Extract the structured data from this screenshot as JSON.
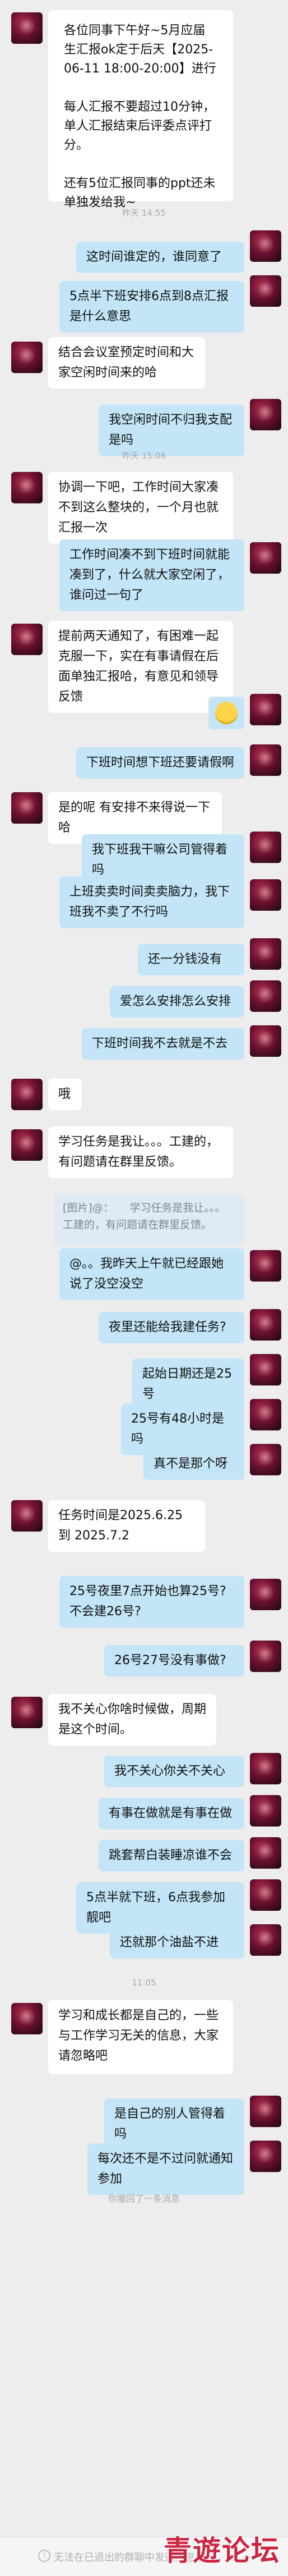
{
  "messages": [
    {
      "type": "in",
      "text": "各位同事下午好~5月应届生汇报ok定于后天【2025-06-11 18:00-20:00】进行\n\n每人汇报不要超过10分钟，单人汇报结束后评委点评打分。\n\n还有5位汇报同事的ppt还未单独发给我~"
    },
    {
      "type": "time",
      "text": "昨天 14:55"
    },
    {
      "type": "out",
      "text": "这时间谁定的，谁同意了"
    },
    {
      "type": "out",
      "text": "5点半下班安排6点到8点汇报是什么意思"
    },
    {
      "type": "in",
      "text": "结合会议室预定时间和大家空闲时间来的哈"
    },
    {
      "type": "out",
      "text": "我空闲时间不归我支配是吗"
    },
    {
      "type": "time",
      "text": "昨天 15:06"
    },
    {
      "type": "in",
      "text": "协调一下吧，工作时间大家凑不到这么整块的，一个月也就汇报一次"
    },
    {
      "type": "out",
      "text": "工作时间凑不到下班时间就能凑到了，什么就大家空闲了，谁问过一句了"
    },
    {
      "type": "in",
      "text": "提前两天通知了，有困难一起克服一下，实在有事请假在后面单独汇报哈，有意见和领导反馈"
    },
    {
      "type": "out",
      "text": "下班时间想下班还要请假啊"
    },
    {
      "type": "in",
      "text": "是的呢 有安排不来得说一下哈"
    },
    {
      "type": "out",
      "text": "我下班我干嘛公司管得着吗"
    },
    {
      "type": "out",
      "text": "上班卖卖时间卖卖脑力，我下班我不卖了不行吗"
    },
    {
      "type": "out",
      "text": "还一分钱没有"
    },
    {
      "type": "out",
      "text": "爱怎么安排怎么安排"
    },
    {
      "type": "out",
      "text": "下班时间我不去就是不去"
    },
    {
      "type": "in",
      "text": "哦"
    },
    {
      "type": "in",
      "text": "学习任务是我让。。。工建的，有问题请在群里反馈。"
    },
    {
      "type": "quote",
      "text": "[图片]@：　　学习任务是我让。。。工建的，有问题请在群里反馈。"
    },
    {
      "type": "out",
      "text": "@。。我昨天上午就已经跟她说了没空没空"
    },
    {
      "type": "out",
      "text": "夜里还能给我建任务?"
    },
    {
      "type": "out",
      "text": "起始日期还是25号"
    },
    {
      "type": "out",
      "text": "25号有48小时是吗"
    },
    {
      "type": "out",
      "text": "真不是那个呀"
    },
    {
      "type": "in",
      "text": "任务时间是2025.6.25 到 2025.7.2"
    },
    {
      "type": "out",
      "text": "25号夜里7点开始也算25号? 不会建26号?"
    },
    {
      "type": "out",
      "text": "26号27号没有事做?"
    },
    {
      "type": "in",
      "text": "我不关心你啥时候做，周期是这个时间。"
    },
    {
      "type": "out",
      "text": "我不关心你关不关心"
    },
    {
      "type": "out",
      "text": "有事在做就是有事在做"
    },
    {
      "type": "out",
      "text": "跳套帮白装睡凉谁不会"
    },
    {
      "type": "out",
      "text": "5点半就下班，6点我参加靓吧"
    },
    {
      "type": "out",
      "text": "还就那个油盐不进"
    },
    {
      "type": "time",
      "text": "11:05"
    },
    {
      "type": "in",
      "text": "学习和成长都是自己的，一些与工作学习无关的信息，大家请忽略吧"
    },
    {
      "type": "out",
      "text": "是自己的别人管得着吗"
    },
    {
      "type": "out",
      "text": "每次还不是不过问就通知参加"
    }
  ],
  "recall_note": "你撤回了一条消息",
  "footer_note": "无法在已退出的群聊中发送消息",
  "watermark": "青遊论坛",
  "colors": {
    "outgoing_bubble": "#c3e5f7",
    "incoming_bubble": "#ffffff",
    "background": "#ededed"
  },
  "icons": {
    "avatar": "avatar-image",
    "info": "info-icon",
    "emoji": "laughing-emoji-icon"
  }
}
